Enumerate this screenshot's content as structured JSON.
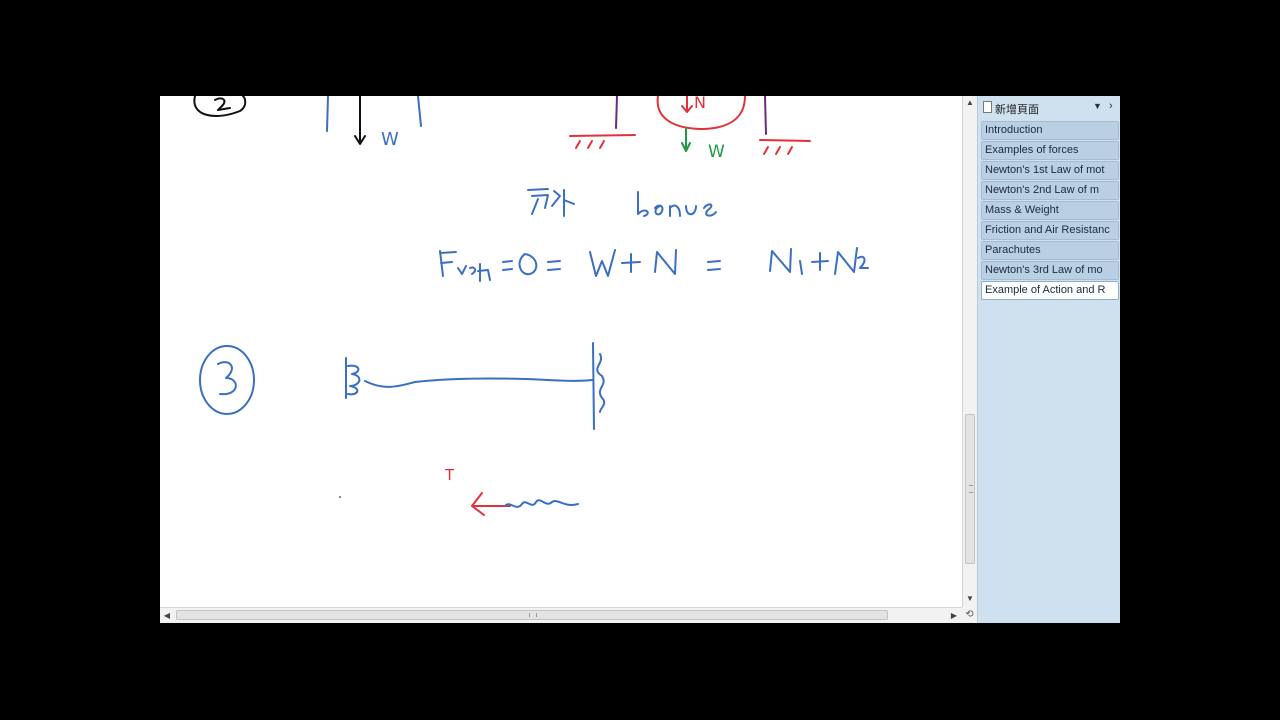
{
  "canvas": {
    "labels": {
      "w_left": "W",
      "w_right": "W",
      "n": "N",
      "tension": "T",
      "circle_3": "3",
      "chinese_note": "另外 bonus",
      "equation": "F net = 0 = W + N = N1 + N2"
    },
    "ink_colors": {
      "blue": "#3a6fc1",
      "red": "#e0323a",
      "green": "#1f9a45",
      "black": "#111111"
    }
  },
  "scrollbars": {
    "up_icon": "arrow-up-icon",
    "down_icon": "arrow-down-icon",
    "left_icon": "arrow-left-icon",
    "right_icon": "arrow-right-icon",
    "vertical_position": 0.72,
    "horizontal_position": 0.5
  },
  "page_panel": {
    "new_page_label": "新增頁面",
    "pages": [
      {
        "title": "Introduction",
        "active": false
      },
      {
        "title": "Examples of forces",
        "active": false
      },
      {
        "title": "Newton's 1st Law of mot",
        "active": false
      },
      {
        "title": "Newton's 2nd Law of m",
        "active": false
      },
      {
        "title": "Mass & Weight",
        "active": false
      },
      {
        "title": "Friction and Air Resistanc",
        "active": false
      },
      {
        "title": "Parachutes",
        "active": false
      },
      {
        "title": "Newton's 3rd Law of mo",
        "active": false
      },
      {
        "title": "Example of Action and R",
        "active": true
      }
    ],
    "colors": {
      "panel_bg": "#cfe0ee",
      "tab_bg": "#b9cfe3",
      "active_tab_bg": "#ffffff"
    }
  }
}
